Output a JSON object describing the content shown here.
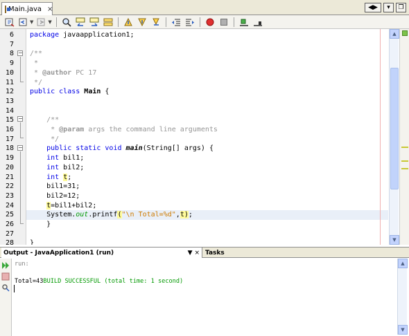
{
  "tabbar": {
    "tab_label": "Main.java",
    "tab_close": "×",
    "nav_left": "◀",
    "nav_right": "▶",
    "dropdown": "▾",
    "restore": "❐"
  },
  "toolbar": {
    "icons": [
      "last-edit-icon",
      "back-icon",
      "forward-icon",
      "find-icon",
      "find-previous-icon",
      "find-next-icon",
      "toggle-highlight-icon",
      "previous-bookmark-icon",
      "next-bookmark-icon",
      "toggle-bookmark-icon",
      "shift-left-icon",
      "shift-right-icon",
      "start-macro-icon",
      "stop-macro-icon",
      "comment-icon",
      "uncomment-icon"
    ]
  },
  "editor": {
    "lines": [
      {
        "num": "6",
        "text": "package javaapplication1;"
      },
      {
        "num": "7",
        "text": ""
      },
      {
        "num": "8",
        "text": "/**"
      },
      {
        "num": "9",
        "text": " *"
      },
      {
        "num": "10",
        "text": " * @author PC 17"
      },
      {
        "num": "11",
        "text": " */"
      },
      {
        "num": "12",
        "text": "public class Main {"
      },
      {
        "num": "13",
        "text": ""
      },
      {
        "num": "14",
        "text": ""
      },
      {
        "num": "15",
        "text": "    /**"
      },
      {
        "num": "16",
        "text": "     * @param args the command line arguments"
      },
      {
        "num": "17",
        "text": "     */"
      },
      {
        "num": "18",
        "text": "    public static void main(String[] args) {"
      },
      {
        "num": "19",
        "text": "    int bil1;"
      },
      {
        "num": "20",
        "text": "    int bil2;"
      },
      {
        "num": "21",
        "text": "    int t;"
      },
      {
        "num": "22",
        "text": "    bil1=31;"
      },
      {
        "num": "23",
        "text": "    bil2=12;"
      },
      {
        "num": "24",
        "text": "    t=bil1+bil2;"
      },
      {
        "num": "25",
        "text": "    System.out.printf(\"\\n Total=%d\",t);"
      },
      {
        "num": "26",
        "text": "    }"
      },
      {
        "num": "27",
        "text": ""
      },
      {
        "num": "28",
        "text": "}"
      }
    ],
    "tokens": {
      "package_kw": "package",
      "package_name": " javaapplication1;",
      "comment_open": "/**",
      "comment_star": " *",
      "author_prefix": " * ",
      "author_tag": "@author",
      "author_name": " PC 17",
      "comment_close": " */",
      "public_kw": "public",
      "class_kw": "class",
      "class_name": "Main",
      "brace_open": " {",
      "doc_open": "    /**",
      "param_prefix": "     * ",
      "param_tag": "@param",
      "param_text": " args the command line arguments",
      "doc_close": "     */",
      "static_kw": "static",
      "void_kw": "void",
      "main_name": "main",
      "main_args": "(String[] args) {",
      "int_kw": "int",
      "bil1_decl": " bil1;",
      "bil2_decl": " bil2;",
      "t_var": "t",
      "semicolon": ";",
      "assign1": "bil1=31;",
      "assign2": "bil2=12;",
      "assign3_rest": "=bil1+bil2;",
      "system": "System.",
      "out_field": "out",
      "printf": ".printf",
      "paren_open": "(",
      "string_lit": "\"\\n Total=%d\"",
      "comma": ",",
      "paren_close": ")",
      "end_semi": ";",
      "method_close": "    }",
      "class_close": "}"
    }
  },
  "output": {
    "tab_label": "Output - JavaApplication1 (run)",
    "tab_controls": "▼ ×",
    "tasks_label": "Tasks",
    "run_text": "run:",
    "total_text": "Total=43",
    "build_text": "BUILD SUCCESSFUL (total time: 1 second)"
  }
}
